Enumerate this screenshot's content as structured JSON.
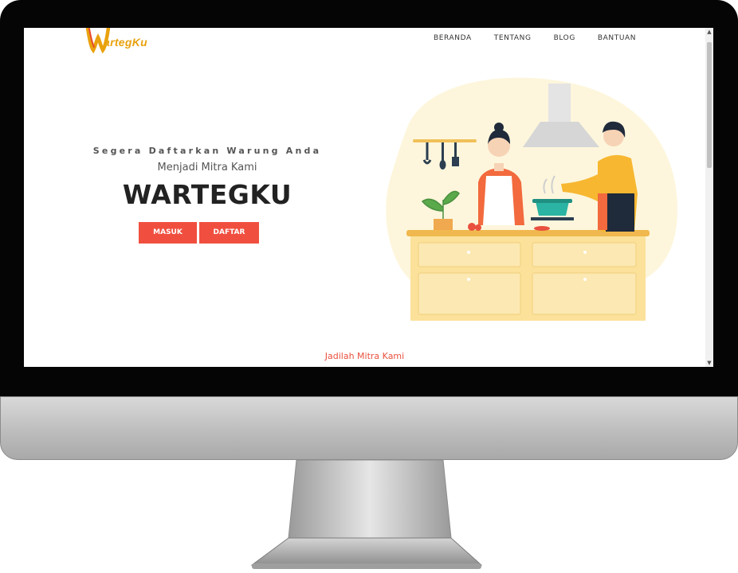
{
  "brand": {
    "logo_text": "artegKu"
  },
  "nav": {
    "items": [
      "BERANDA",
      "TENTANG",
      "BLOG",
      "BANTUAN"
    ]
  },
  "hero": {
    "tagline": "Segera Daftarkan Warung Anda",
    "subtitle": "Menjadi Mitra Kami",
    "title": "WARTEGKU",
    "buttons": {
      "login": "MASUK",
      "register": "DAFTAR"
    }
  },
  "cta": {
    "text": "Jadilah Mitra Kami"
  },
  "colors": {
    "accent": "#f04f3f",
    "logo": "#e9a20f",
    "illustration_bg": "#fdf6dc"
  },
  "illustration": {
    "icon": "kitchen-cooking-illustration"
  }
}
